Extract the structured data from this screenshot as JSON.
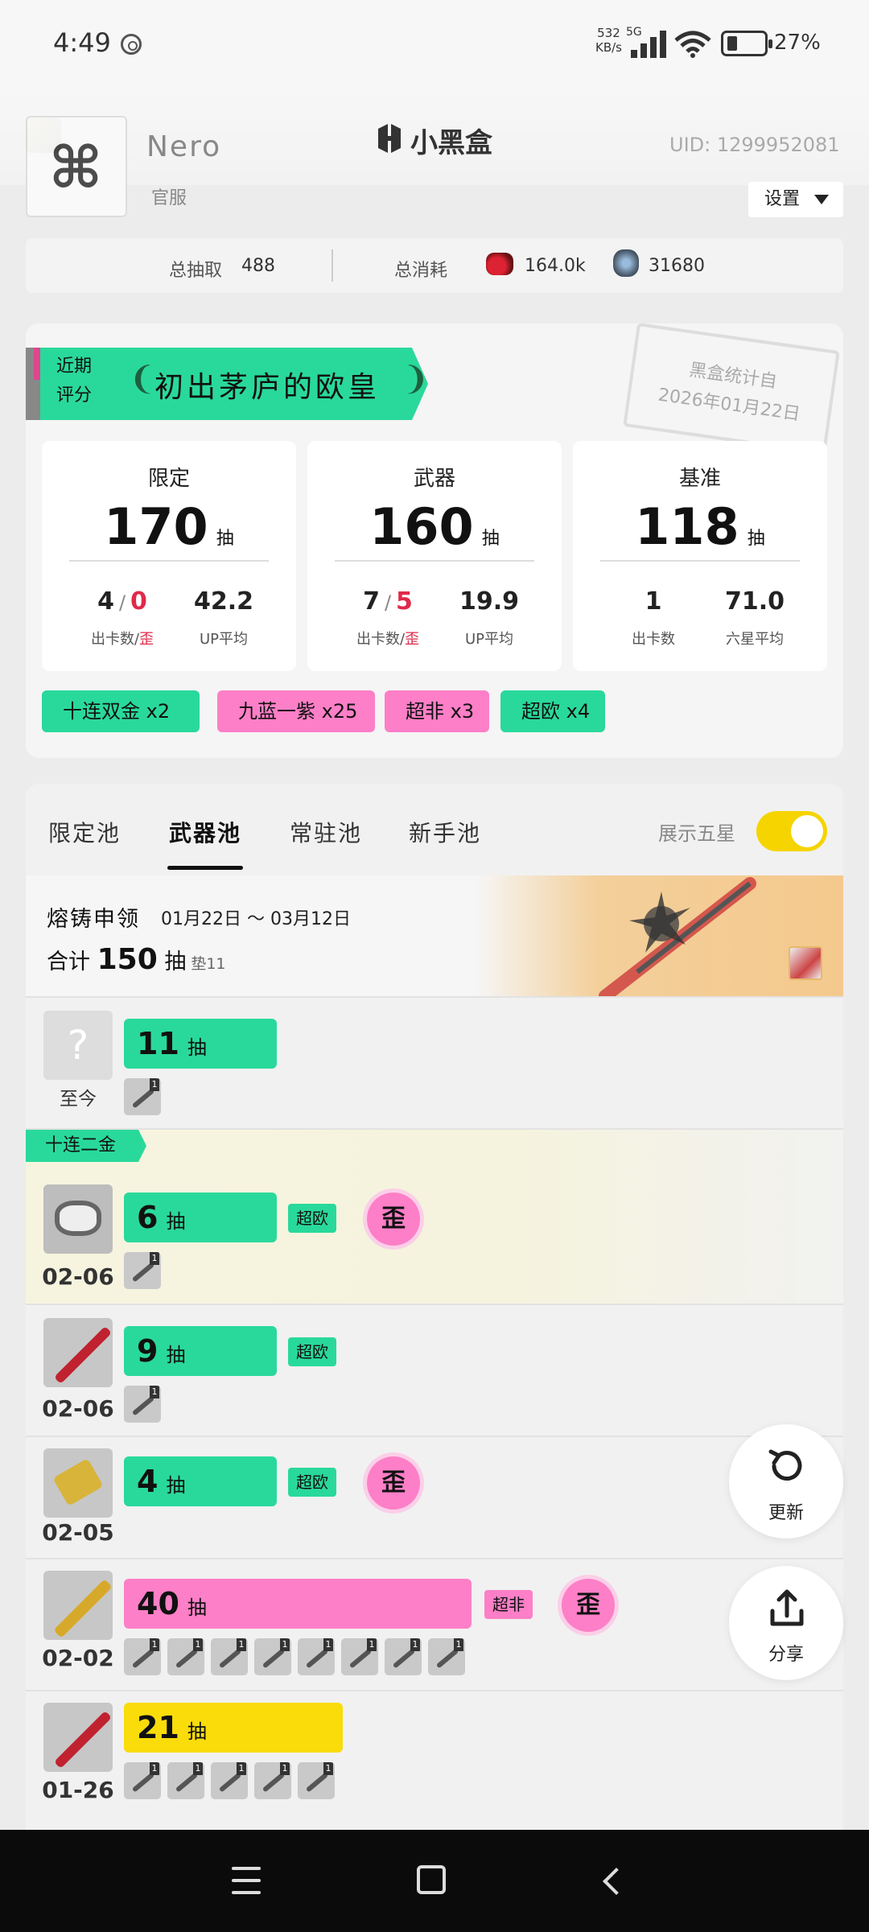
{
  "status": {
    "time": "4:49",
    "net_rate": "532\nKB/s",
    "net_type": "5G",
    "battery": "27%"
  },
  "header": {
    "username": "Nero",
    "brand": "小黑盒",
    "uid": "UID: 1299952081",
    "server": "官服",
    "settings_label": "设置"
  },
  "totals": {
    "draws_label": "总抽取",
    "draws_value": "488",
    "spent_label": "总消耗",
    "spent_value_a": "164.0k",
    "spent_value_b": "31680"
  },
  "score": {
    "label_line1": "近期",
    "label_line2": "评分",
    "title": "初出茅庐的欧皇",
    "stamp_line1": "黑盒统计自",
    "stamp_line2": "2026年01月22日",
    "boxes": [
      {
        "title": "限定",
        "count": "170",
        "unit": "抽",
        "v1a": "4",
        "v1b": "0",
        "v2": "42.2",
        "l1a": "出卡数",
        "l1b": "歪",
        "l2": "UP平均"
      },
      {
        "title": "武器",
        "count": "160",
        "unit": "抽",
        "v1a": "7",
        "v1b": "5",
        "v2": "19.9",
        "l1a": "出卡数",
        "l1b": "歪",
        "l2": "UP平均"
      },
      {
        "title": "基准",
        "count": "118",
        "unit": "抽",
        "v1": "1",
        "v2": "71.0",
        "l1": "出卡数",
        "l2": "六星平均"
      }
    ],
    "tags": [
      "十连双金 x2",
      "九蓝一紫 x25",
      "超非 x3",
      "超欧 x4"
    ]
  },
  "tabs": {
    "items": [
      "限定池",
      "武器池",
      "常驻池",
      "新手池"
    ],
    "active": "武器池",
    "show5_label": "展示五星",
    "show5_on": true
  },
  "pool": {
    "name": "熔铸申领",
    "dates": "01月22日 ～ 03月12日",
    "total_prefix": "合计",
    "total_value": "150",
    "total_unit": "抽",
    "pity": "垫11"
  },
  "rows": [
    {
      "date": "至今",
      "count": "11",
      "unit": "抽",
      "bar_fill": 0.27
    },
    {
      "date": "02-06",
      "count": "6",
      "unit": "抽",
      "badge": "超欧",
      "wai": "歪",
      "ribbon": "十连二金",
      "bar_fill": 0.27
    },
    {
      "date": "02-06",
      "count": "9",
      "unit": "抽",
      "badge": "超欧",
      "bar_fill": 0.27
    },
    {
      "date": "02-05",
      "count": "4",
      "unit": "抽",
      "badge": "超欧",
      "wai": "歪",
      "bar_fill": 0.27
    },
    {
      "date": "02-02",
      "count": "40",
      "unit": "抽",
      "badge": "超非",
      "wai": "歪",
      "bar_fill": 0.62
    },
    {
      "date": "01-26",
      "count": "21",
      "unit": "抽",
      "bar_fill": 0.39
    }
  ],
  "mini_count": "1",
  "fabs": {
    "refresh_label": "更新",
    "share_label": "分享"
  },
  "colors": {
    "green": "#29d99b",
    "pink": "#fd7fc7",
    "yellow": "#f9dc0a",
    "red": "#e02a4a"
  }
}
